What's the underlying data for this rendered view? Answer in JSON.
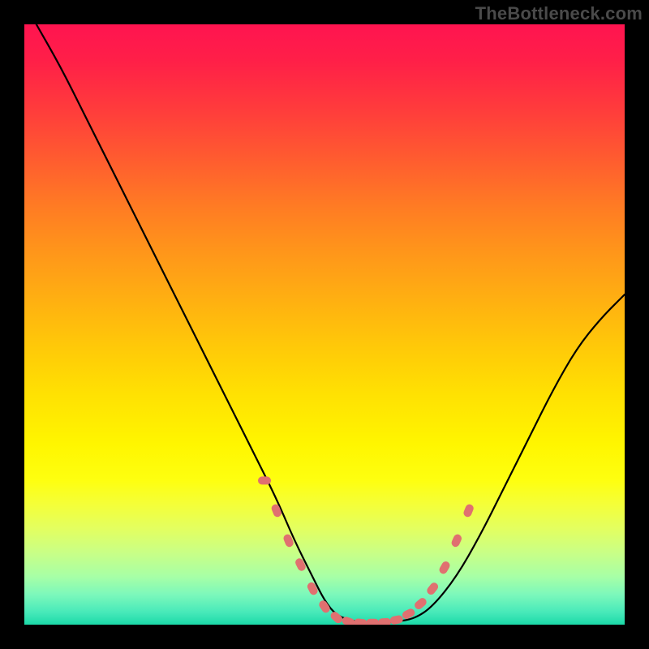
{
  "watermark": "TheBottleneck.com",
  "chart_data": {
    "type": "line",
    "title": "",
    "xlabel": "",
    "ylabel": "",
    "xlim": [
      0,
      100
    ],
    "ylim": [
      0,
      100
    ],
    "grid": false,
    "legend": false,
    "series": [
      {
        "name": "curve",
        "x": [
          2,
          6,
          10,
          14,
          18,
          22,
          26,
          30,
          34,
          38,
          42,
          45,
          48,
          50,
          52,
          55,
          58,
          60,
          62,
          65,
          68,
          72,
          76,
          80,
          84,
          88,
          92,
          96,
          100
        ],
        "y": [
          100,
          93,
          85,
          77,
          69,
          61,
          53,
          45,
          37,
          29,
          21,
          14,
          8,
          4,
          1.5,
          0.5,
          0.3,
          0.3,
          0.5,
          1.0,
          3,
          8,
          15,
          23,
          31,
          39,
          46,
          51,
          55
        ]
      }
    ],
    "markers": {
      "name": "highlight-points",
      "color": "#e07070",
      "x": [
        40,
        42,
        44,
        46,
        48,
        50,
        52,
        54,
        56,
        58,
        60,
        62,
        64,
        66,
        68,
        70,
        72,
        74
      ],
      "y": [
        24,
        19,
        14,
        10,
        6,
        3,
        1.2,
        0.5,
        0.3,
        0.3,
        0.4,
        0.8,
        1.8,
        3.5,
        6,
        9.5,
        14,
        19
      ]
    },
    "background_gradient": {
      "direction": "vertical",
      "stops": [
        {
          "pos": 0.0,
          "color": "#ff1450"
        },
        {
          "pos": 0.3,
          "color": "#ff7a24"
        },
        {
          "pos": 0.62,
          "color": "#ffe202"
        },
        {
          "pos": 0.8,
          "color": "#f4ff39"
        },
        {
          "pos": 0.92,
          "color": "#a7ffa6"
        },
        {
          "pos": 1.0,
          "color": "#1bd9a8"
        }
      ]
    }
  }
}
